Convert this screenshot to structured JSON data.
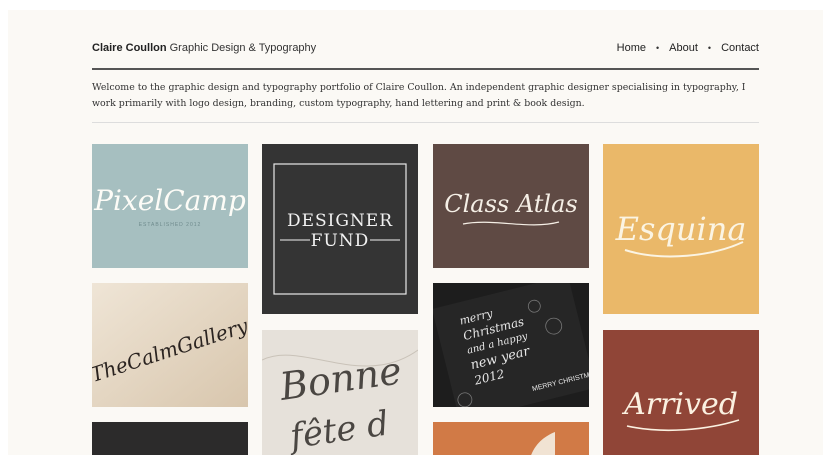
{
  "header": {
    "site_name": "Claire Coullon",
    "tagline": "Graphic Design & Typography",
    "nav": [
      {
        "label": "Home"
      },
      {
        "label": "About"
      },
      {
        "label": "Contact"
      }
    ],
    "nav_separator": "•"
  },
  "intro": {
    "text": "Welcome to the graphic design and typography portfolio of Claire Coullon. An independent graphic designer specialising in typography, I work primarily with logo design, branding, custom typography, hand lettering and print & book design."
  },
  "portfolio": {
    "tiles": [
      {
        "id": "pixelcamp",
        "title": "PixelCamp",
        "subtitle": "ESTABLISHED 2012",
        "color": "#a6bfc0"
      },
      {
        "id": "designer-fund",
        "title_line1": "DESIGNER",
        "title_line2": "FUND",
        "color": "#343434"
      },
      {
        "id": "class-atlas",
        "title": "Class Atlas",
        "color": "#5f4a44"
      },
      {
        "id": "esquina",
        "title": "Esquina",
        "color": "#eab869"
      },
      {
        "id": "calm-gallery",
        "title": "TheCalmGallery",
        "color": "#e9dcc9"
      },
      {
        "id": "bonne-fete",
        "line1": "Bonne",
        "line2": "fête d",
        "color": "#e6e1da"
      },
      {
        "id": "merry-christmas",
        "line1": "merry",
        "line2": "Christmas",
        "line3": "and a happy",
        "line4": "new year",
        "line5": "2012",
        "footer": "MERRY CHRISTMAS",
        "color": "#1d1d1d"
      },
      {
        "id": "arrived",
        "title": "Arrived",
        "color": "#904537"
      },
      {
        "id": "dark-tile",
        "color": "#2c2b2b"
      },
      {
        "id": "orange-tile",
        "color": "#d17a46"
      }
    ]
  }
}
